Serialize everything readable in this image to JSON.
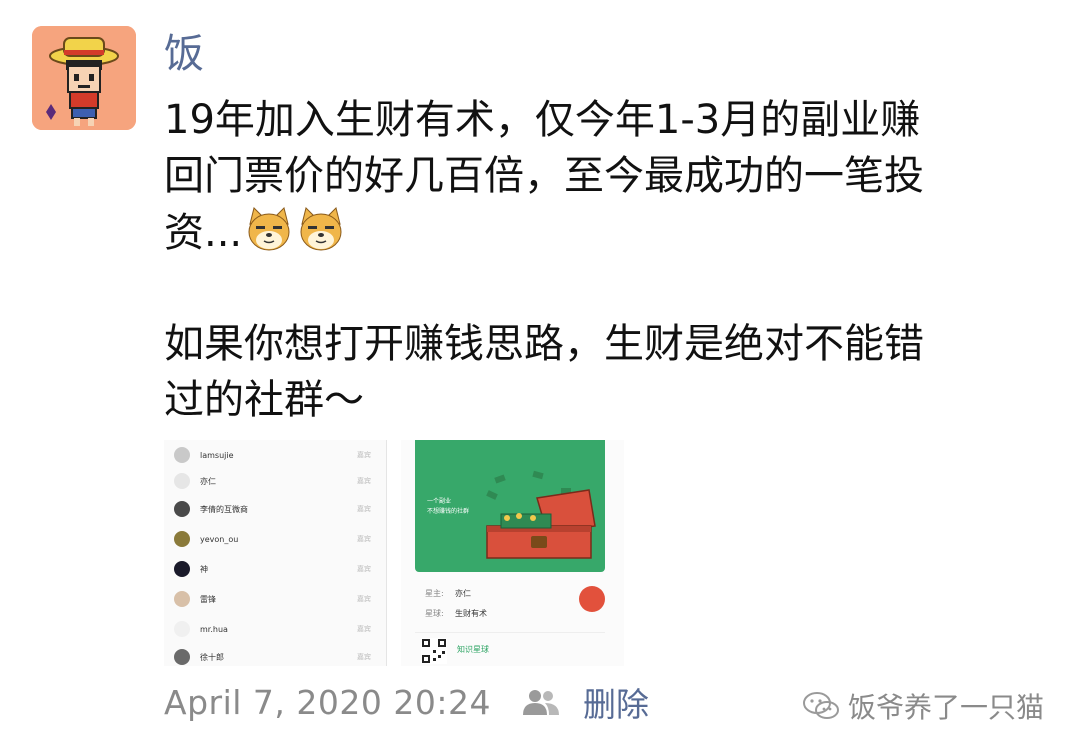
{
  "post": {
    "author": "饭",
    "content_lines": [
      "19年加入生财有术，仅今年1-3月的副业赚",
      "回门票价的好几百倍，至今最成功的一笔投",
      "资...",
      "",
      "如果你想打开赚钱思路，生财是绝对不能错",
      "过的社群～"
    ],
    "emoji_count": 2,
    "emoji_name": "doge-emoji"
  },
  "screenshot_left": {
    "rows": [
      {
        "name": "lamsujie",
        "tag": "嘉宾"
      },
      {
        "name": "亦仁",
        "tag": "嘉宾"
      },
      {
        "name": "李倩的互微商",
        "tag": "嘉宾"
      },
      {
        "name": "yevon_ou",
        "tag": "嘉宾"
      },
      {
        "name": "神",
        "tag": "嘉宾"
      },
      {
        "name": "雷锋",
        "tag": "嘉宾"
      },
      {
        "name": "mr.hua",
        "tag": "嘉宾"
      },
      {
        "name": "徐十郎",
        "tag": "嘉宾"
      }
    ]
  },
  "screenshot_right": {
    "card_line1": "一个副业",
    "card_line2": "不想赚钱的社群",
    "owner_label": "星主:",
    "owner_name": "亦仁",
    "group_label": "星球:",
    "group_name": "生财有术",
    "brand": "知识星球"
  },
  "footer": {
    "timestamp": "April 7, 2020 20:24",
    "delete_label": "删除",
    "people_icon": "people-icon"
  },
  "watermark": {
    "text": "饭爷养了一只猫",
    "icon": "wechat-icon"
  },
  "colors": {
    "link": "#576b95",
    "meta": "#8a8a8a",
    "avatar_bg": "#f6a47e",
    "card_green": "#37a86a"
  }
}
